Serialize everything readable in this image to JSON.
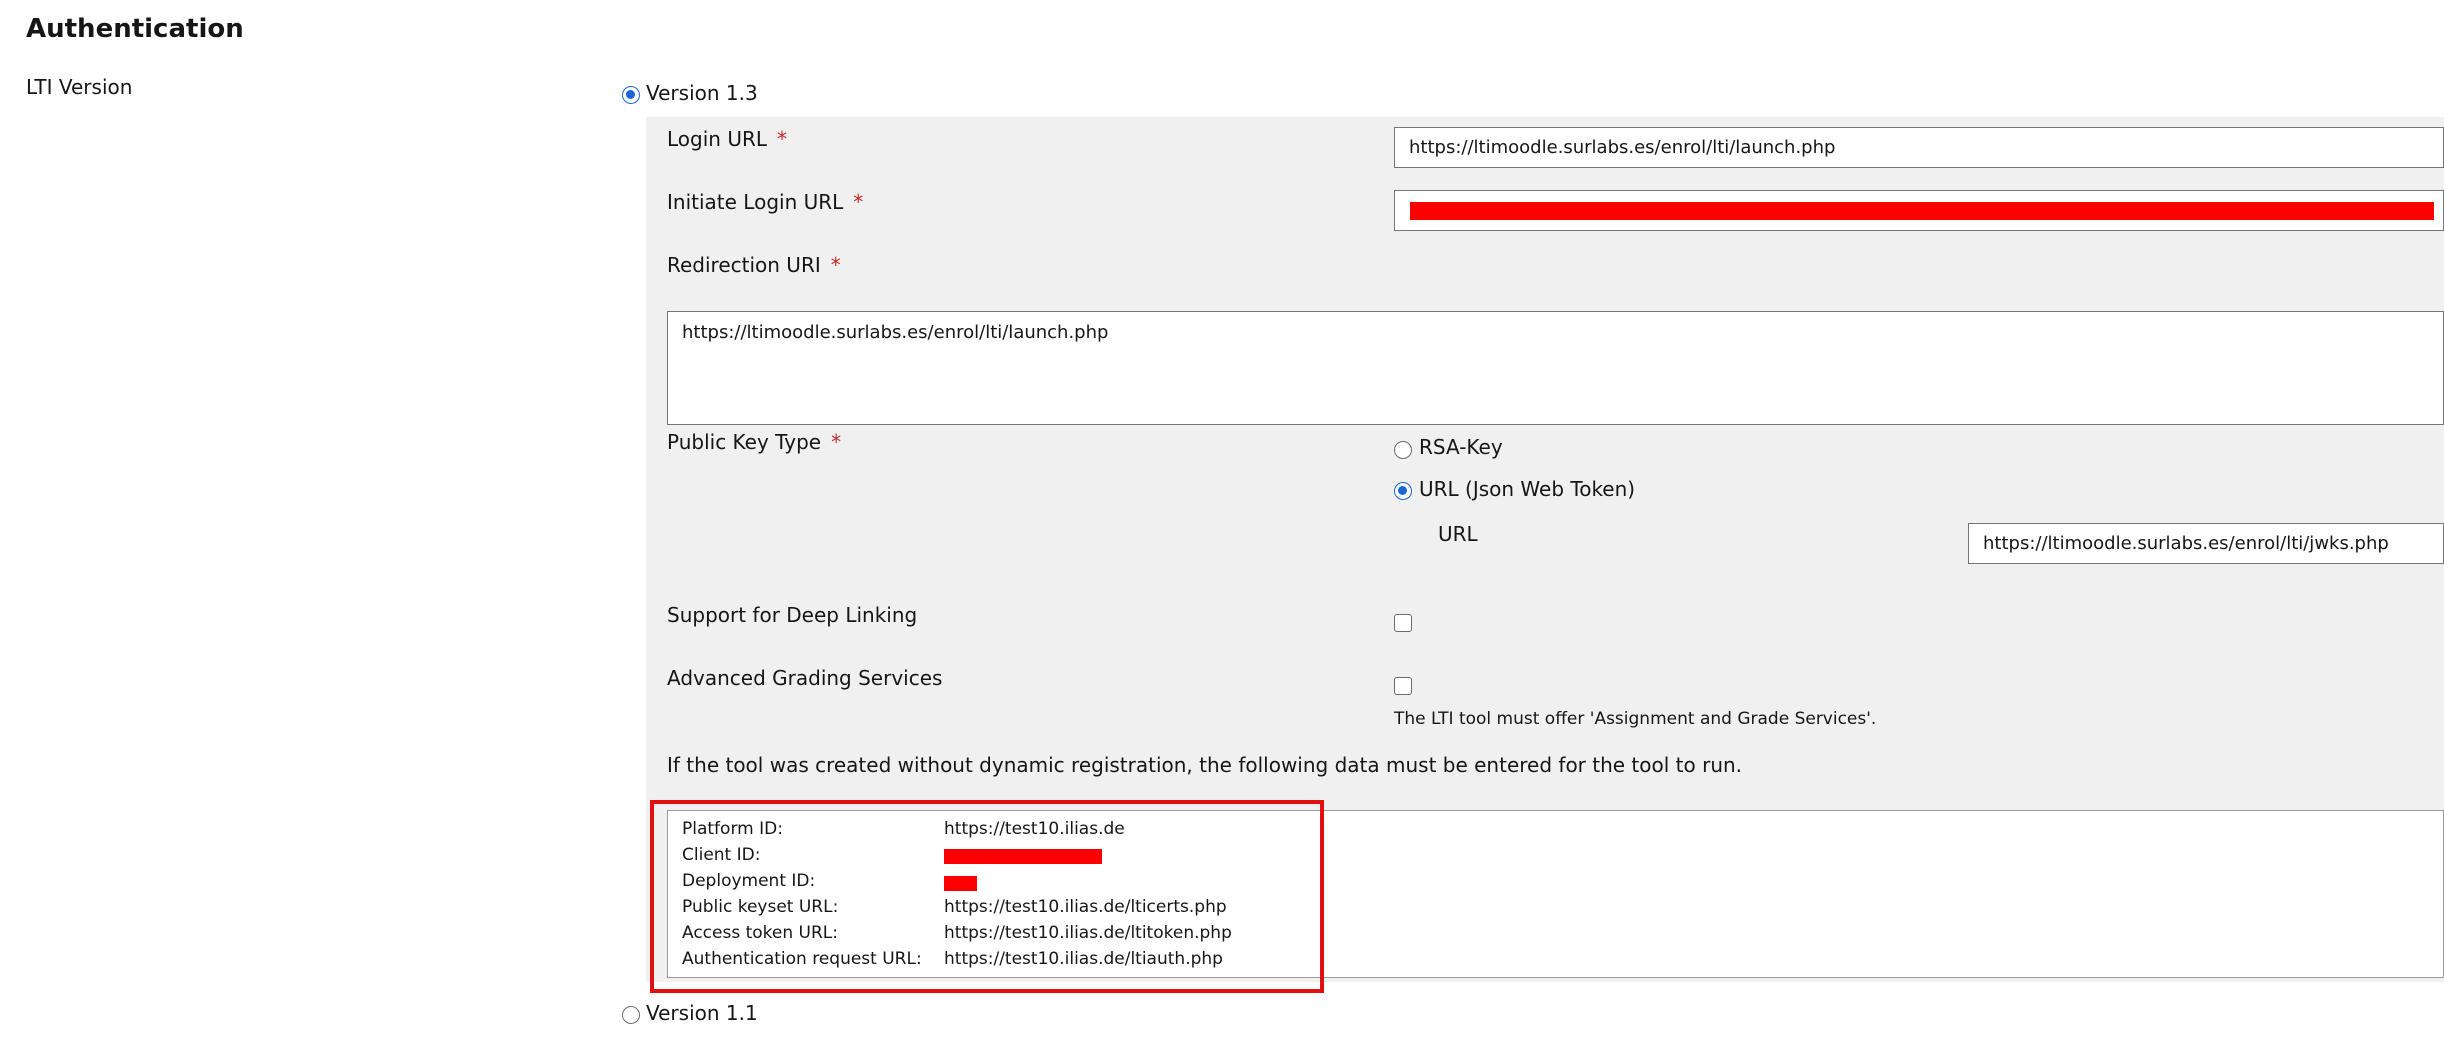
{
  "section": {
    "title": "Authentication"
  },
  "lti_version": {
    "label": "LTI Version",
    "option_13": "Version 1.3",
    "option_11": "Version 1.1",
    "selected": "Version 1.3"
  },
  "form": {
    "login_url": {
      "label": "Login URL",
      "required": "*",
      "value": "https://ltimoodle.surlabs.es/enrol/lti/launch.php"
    },
    "initiate_login_url": {
      "label": "Initiate Login URL",
      "required": "*"
    },
    "redirection_uri": {
      "label": "Redirection URI",
      "required": "*",
      "value": "https://ltimoodle.surlabs.es/enrol/lti/launch.php"
    },
    "public_key_type": {
      "label": "Public Key Type",
      "required": "*",
      "option_rsa": "RSA-Key",
      "option_url": "URL (Json Web Token)",
      "selected": "URL (Json Web Token)",
      "url_label": "URL",
      "url_value": "https://ltimoodle.surlabs.es/enrol/lti/jwks.php"
    },
    "deep_linking": {
      "label": "Support for Deep Linking"
    },
    "advanced_grading": {
      "label": "Advanced Grading Services",
      "hint": "The LTI tool must offer 'Assignment and Grade Services'."
    },
    "notice": "If the tool was created without dynamic registration, the following data must be entered for the tool to run."
  },
  "platform_info": {
    "rows": [
      {
        "key": "Platform ID:",
        "value": "https://test10.ilias.de"
      },
      {
        "key": "Client ID:",
        "value": ""
      },
      {
        "key": "Deployment ID:",
        "value": ""
      },
      {
        "key": "Public keyset URL:",
        "value": "https://test10.ilias.de/lticerts.php"
      },
      {
        "key": "Access token URL:",
        "value": "https://test10.ilias.de/ltitoken.php"
      },
      {
        "key": "Authentication request URL:",
        "value": "https://test10.ilias.de/ltiauth.php"
      }
    ]
  },
  "colors": {
    "required": "#c42727",
    "radio_selected": "#1a66d6",
    "panel_bg": "#f0f0f0",
    "highlight": "#e01010",
    "redaction": "#ff0000"
  }
}
